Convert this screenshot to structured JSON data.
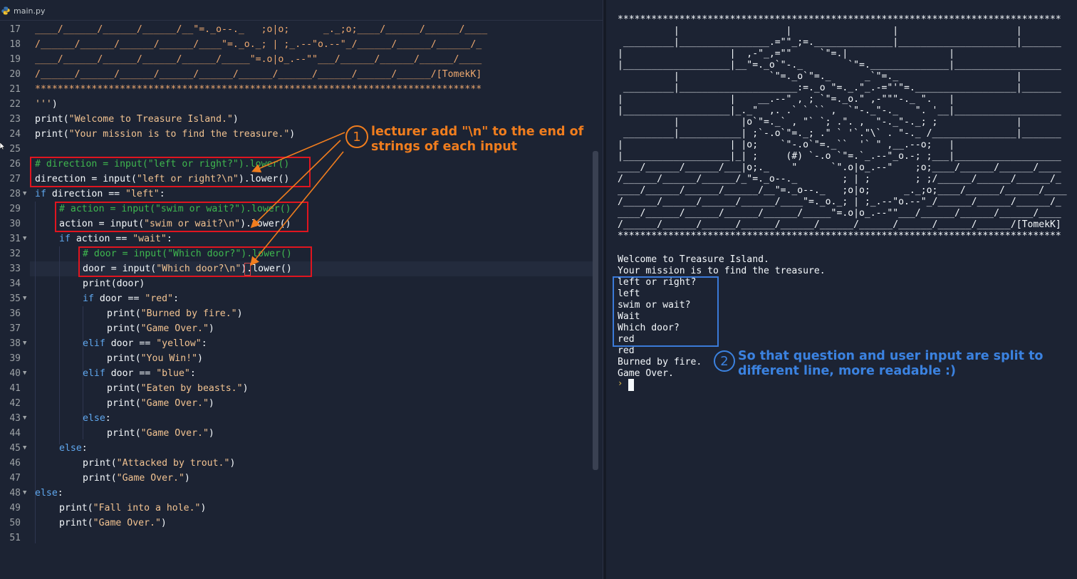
{
  "tab": {
    "filename": "main.py",
    "icon": "python-file-icon"
  },
  "editor": {
    "line_numbers": [
      "17",
      "18",
      "19",
      "20",
      "21",
      "22",
      "23",
      "24",
      "25",
      "26",
      "27",
      "28",
      "29",
      "30",
      "31",
      "32",
      "33",
      "34",
      "35",
      "36",
      "37",
      "38",
      "39",
      "40",
      "41",
      "42",
      "43",
      "44",
      "45",
      "46",
      "47",
      "48",
      "49",
      "50",
      "51"
    ],
    "lines": {
      "l17": "____/______/______/______/__\"=._o--._   ;o|o;      _._;o;____/______/______/____",
      "l18": "/______/______/______/______/____\"=._o._; | ;_.--\"o.--\"_/______/______/______/_",
      "l19": "____/______/______/______/______/_____\"=.o|o_.--\"\"___/______/______/______/____",
      "l20": "/______/______/______/______/______/______/______/______/______/______/[TomekK]",
      "l21": "*******************************************************************************",
      "l22_str": "'''",
      "l22_paren": ")",
      "l23_fn": "print(",
      "l23_str": "\"Welcome to Treasure Island.\"",
      "l23_end": ")",
      "l24_fn": "print(",
      "l24_str": "\"Your mission is to find the treasure.\"",
      "l24_end": ")",
      "l26": "# direction = input(\"left or right?\").lower()",
      "l27_a": "direction = input(",
      "l27_str": "\"left or right?\\n\"",
      "l27_b": ").lower()",
      "l28_kw": "if",
      "l28_a": " direction == ",
      "l28_str": "\"left\"",
      "l28_b": ":",
      "l29": "# action = input(\"swim or wait?\").lower()",
      "l30_a": "action = input(",
      "l30_str": "\"swim or wait?\\n\"",
      "l30_b": ").lower()",
      "l31_kw": "if",
      "l31_a": " action == ",
      "l31_str": "\"wait\"",
      "l31_b": ":",
      "l32": "# door = input(\"Which door?\").lower()",
      "l33_a": "door = input(",
      "l33_str": "\"Which door?\\n\"",
      "l33_b": ").lower()",
      "l34": "print(door)",
      "l35_kw": "if",
      "l35_a": " door == ",
      "l35_str": "\"red\"",
      "l35_b": ":",
      "l36_a": "print(",
      "l36_str": "\"Burned by fire.\"",
      "l36_b": ")",
      "l37_a": "print(",
      "l37_str": "\"Game Over.\"",
      "l37_b": ")",
      "l38_kw": "elif",
      "l38_a": " door == ",
      "l38_str": "\"yellow\"",
      "l38_b": ":",
      "l39_a": "print(",
      "l39_str": "\"You Win!\"",
      "l39_b": ")",
      "l40_kw": "elif",
      "l40_a": " door == ",
      "l40_str": "\"blue\"",
      "l40_b": ":",
      "l41_a": "print(",
      "l41_str": "\"Eaten by beasts.\"",
      "l41_b": ")",
      "l42_a": "print(",
      "l42_str": "\"Game Over.\"",
      "l42_b": ")",
      "l43_kw": "else",
      "l43_b": ":",
      "l44_a": "print(",
      "l44_str": "\"Game Over.\"",
      "l44_b": ")",
      "l45_kw": "else",
      "l45_b": ":",
      "l46_a": "print(",
      "l46_str": "\"Attacked by trout.\"",
      "l46_b": ")",
      "l47_a": "print(",
      "l47_str": "\"Game Over.\"",
      "l47_b": ")",
      "l48_kw": "else",
      "l48_b": ":",
      "l49_a": "print(",
      "l49_str": "\"Fall into a hole.\"",
      "l49_b": ")",
      "l50_a": "print(",
      "l50_str": "\"Game Over.\"",
      "l50_b": ")"
    }
  },
  "console": {
    "art": [
      "*******************************************************************************",
      "          |                   |                  |                     |",
      " _________|________________.=\"\"_;=.______________|_____________________|_______",
      "|                   |  ,-\"_,=\"\"     `\"=.|                  |",
      "|___________________|__\"=._o`\"-._        `\"=.______________|___________________",
      "          |                `\"=._o`\"=._      _`\"=._                     |",
      " _________|_____________________:=._o \"=._.\"_.-=\"'\"=.__________________|_______",
      "|                   |    __.--\" , ; `\"=._o.\" ,-\"\"\"-._ \".   |",
      "|___________________|_._\"  ,. .` ` `` ,  `\"-._\"-._   \". '__|___________________",
      "          |           |o`\"=._` , \"` `; .\". ,  \"-._\"-._; ;              |",
      " _________|___________| ;`-.o`\"=._; .\" ` '`.\"\\` . \"-._ /_______________|_______",
      "|                   | |o;    `\"-.o`\"=._``  '` \" ,__.--o;   |",
      "|___________________|_| ;     (#) `-.o `\"=.`_.--\"_o.-; ;___|___________________",
      "____/______/______/___|o;._    \"      `\".o|o_.--\"    ;o;____/______/______/____",
      "/______/______/______/_\"=._o--._        ; | ;        ; ;/______/______/______/_",
      "____/______/______/______/__\"=._o--._   ;o|o;      _._;o;____/______/______/____",
      "/______/______/______/______/____\"=._o._; | ;_.--\"o.--\"_/______/______/______/_",
      "____/______/______/______/______/_____\"=.o|o_.--\"\"___/______/______/______/____",
      "/______/______/______/______/______/______/______/______/______/______/[TomekK]",
      "*******************************************************************************"
    ],
    "output": [
      "Welcome to Treasure Island.",
      "Your mission is to find the treasure.",
      "left or right?",
      "left",
      "swim or wait?",
      "Wait",
      "Which door?",
      "red",
      "red",
      "Burned by fire.",
      "Game Over."
    ],
    "prompt": "›"
  },
  "annotations": {
    "one_number": "1",
    "one_line1": "lecturer add \"\\n\" to the end of",
    "one_line2": "strings of each input",
    "two_number": "2",
    "two_line1": "So that question and user input are split to",
    "two_line2": "different line, more readable :)",
    "orange": "#f07d1e",
    "blue": "#3b82e0",
    "red": "#e0151f"
  }
}
